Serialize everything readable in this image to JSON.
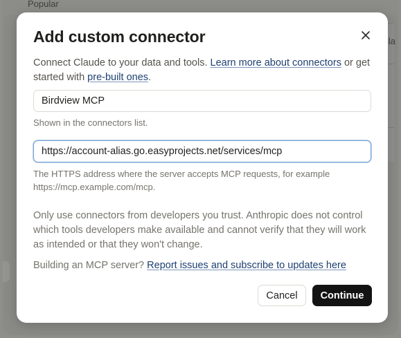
{
  "backdrop": {
    "popular_label": "Popular",
    "side_text": "Sla"
  },
  "dialog": {
    "title": "Add custom connector",
    "close_icon": "close-icon",
    "intro": {
      "text_before": "Connect Claude to your data and tools. ",
      "learn_link": "Learn more about connectors",
      "text_middle": " or get started with ",
      "prebuilt_link": "pre-built ones",
      "text_after": "."
    },
    "name_field": {
      "value": "Birdview MCP",
      "hint": "Shown in the connectors list."
    },
    "url_field": {
      "value": "https://account-alias.go.easyprojects.net/services/mcp",
      "hint": "The HTTPS address where the server accepts MCP requests, for example https://mcp.example.com/mcp."
    },
    "warning": "Only use connectors from developers you trust. Anthropic does not control which tools developers make available and cannot verify that they will work as intended or that they won't change.",
    "building": {
      "text": "Building an MCP server? ",
      "link": "Report issues and subscribe to updates here"
    },
    "buttons": {
      "cancel": "Cancel",
      "continue": "Continue"
    }
  },
  "colors": {
    "link": "#1d3f70",
    "primary_button": "#131313",
    "focus_border": "#7aa3d6"
  }
}
